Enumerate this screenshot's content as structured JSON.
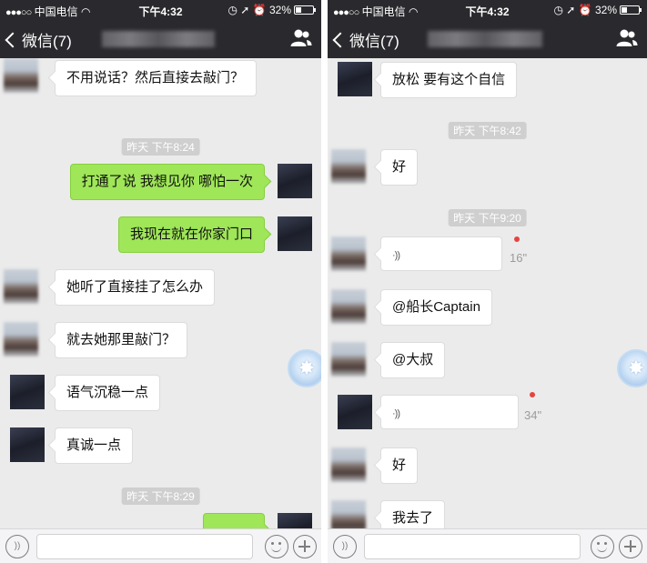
{
  "colors": {
    "header": "#2a2a2e",
    "chat_bg": "#ebebeb",
    "out_bubble": "#9fe658",
    "in_bubble": "#ffffff",
    "unread_dot": "#e64340"
  },
  "left": {
    "status": {
      "carrier": "中国电信",
      "time": "下午4:32",
      "battery": "32%"
    },
    "nav": {
      "back_label": "微信(7)"
    },
    "messages": {
      "m1": "不用说话？然后直接去敲门？",
      "t1": "昨天 下午8:24",
      "m2": "打通了说 我想见你 哪怕一次",
      "m3": "我现在就在你家门口",
      "m4": "她听了直接挂了怎么办",
      "m5": "就去她那里敲门？",
      "m6": "语气沉稳一点",
      "m7": "真诚一点",
      "t2": "昨天 下午8:29"
    }
  },
  "right": {
    "status": {
      "carrier": "中国电信",
      "time": "下午4:32",
      "battery": "32%"
    },
    "nav": {
      "back_label": "微信(7)"
    },
    "messages": {
      "m1": "放松 要有这个自信",
      "t1": "昨天 下午8:42",
      "m2": "好",
      "t2": "昨天 下午9:20",
      "v1_duration": "16\"",
      "m3": "@船长Captain",
      "m4": "@大叔",
      "v2_duration": "34\"",
      "m5": "好",
      "m6": "我去了"
    }
  },
  "icons": {
    "back": "chevron-left-icon",
    "contacts": "contacts-icon",
    "voice": "voice-icon",
    "emoji": "emoji-icon",
    "plus": "plus-icon",
    "float": "floating-star-icon"
  }
}
